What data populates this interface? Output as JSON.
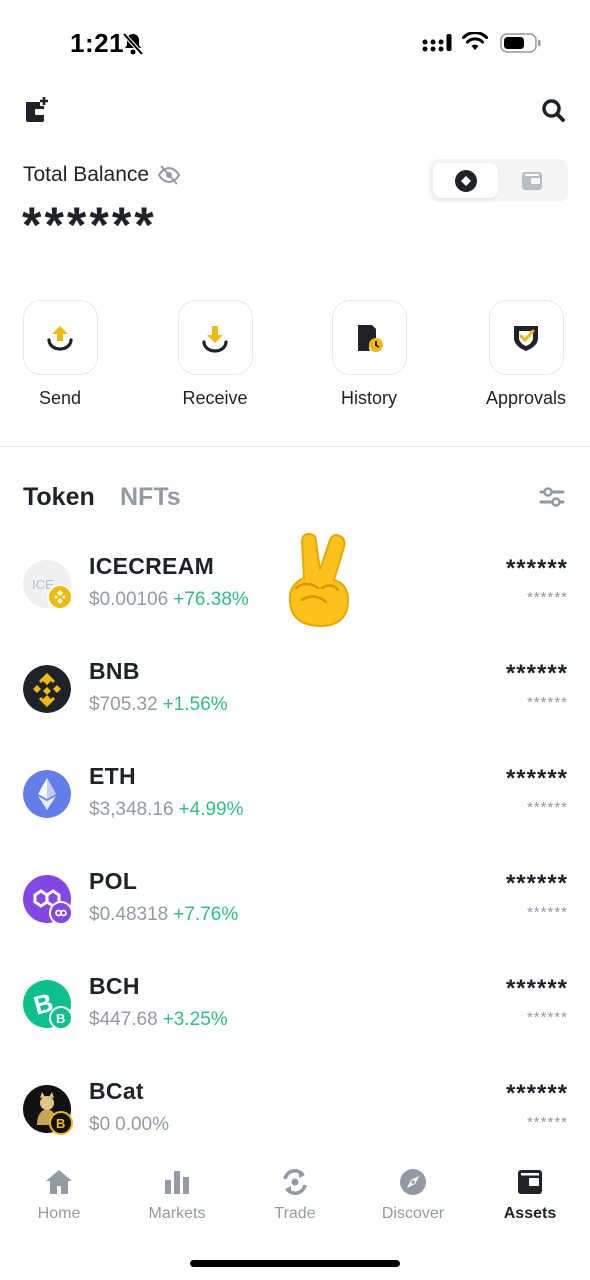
{
  "status_bar": {
    "time": "1:21"
  },
  "balance": {
    "label": "Total Balance",
    "value": "******"
  },
  "actions": [
    {
      "label": "Send",
      "icon": "send-icon"
    },
    {
      "label": "Receive",
      "icon": "receive-icon"
    },
    {
      "label": "History",
      "icon": "history-icon"
    },
    {
      "label": "Approvals",
      "icon": "approvals-icon"
    }
  ],
  "tabs": {
    "token": "Token",
    "nfts": "NFTs"
  },
  "tokens": [
    {
      "name": "ICECREAM",
      "price": "$0.00106",
      "change": "+76.38%",
      "amount": "******",
      "value": "******",
      "logo_text": "ICE"
    },
    {
      "name": "BNB",
      "price": "$705.32",
      "change": "+1.56%",
      "amount": "******",
      "value": "******"
    },
    {
      "name": "ETH",
      "price": "$3,348.16",
      "change": "+4.99%",
      "amount": "******",
      "value": "******"
    },
    {
      "name": "POL",
      "price": "$0.48318",
      "change": "+7.76%",
      "amount": "******",
      "value": "******"
    },
    {
      "name": "BCH",
      "price": "$447.68",
      "change": "+3.25%",
      "amount": "******",
      "value": "******"
    },
    {
      "name": "BCat",
      "price": "$0",
      "change": "0.00%",
      "amount": "******",
      "value": "******"
    }
  ],
  "bottom_nav": [
    {
      "label": "Home",
      "icon": "home-icon"
    },
    {
      "label": "Markets",
      "icon": "markets-icon"
    },
    {
      "label": "Trade",
      "icon": "trade-icon"
    },
    {
      "label": "Discover",
      "icon": "discover-icon"
    },
    {
      "label": "Assets",
      "icon": "assets-icon",
      "active": true
    }
  ],
  "colors": {
    "accent": "#f0b90b",
    "positive": "#2ebd85",
    "muted": "#929aa5",
    "text": "#1e2329"
  }
}
